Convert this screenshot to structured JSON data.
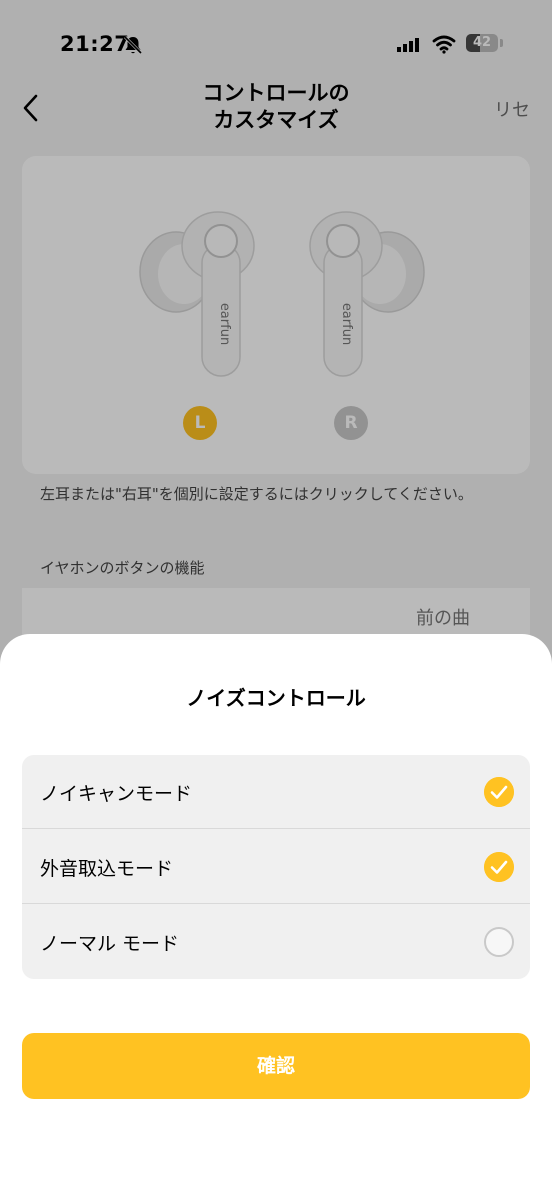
{
  "status_bar": {
    "time": "21:27",
    "battery": "42"
  },
  "nav": {
    "title_line1": "コントロールの",
    "title_line2": "カスタマイズ",
    "reset_label": "リセ"
  },
  "earbuds": {
    "brand_text": "earfun",
    "left_label": "L",
    "right_label": "R",
    "selected": "L"
  },
  "hint_text": "左耳または\"右耳\"を個別に設定するにはクリックしてください。",
  "section_title": "イヤホンのボタンの機能",
  "function_row_value": "前の曲",
  "sheet": {
    "title": "ノイズコントロール",
    "options": [
      {
        "label": "ノイキャンモード",
        "checked": true
      },
      {
        "label": "外音取込モード",
        "checked": true
      },
      {
        "label": "ノーマル モード",
        "checked": false
      }
    ],
    "confirm_label": "確認"
  },
  "colors": {
    "accent": "#ffc222",
    "overlay": "rgba(0,0,0,0.27)"
  }
}
